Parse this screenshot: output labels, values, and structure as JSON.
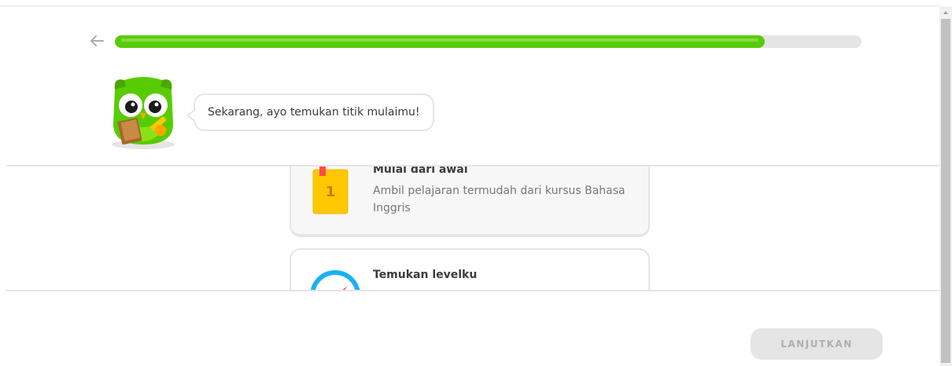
{
  "header": {
    "back_icon": "arrow-left-icon",
    "progress": 0.87
  },
  "mascot": {
    "speech": "Sekarang, ayo temukan titik mulaimu!"
  },
  "options": [
    {
      "title": "Mulai dari awal",
      "description": "Ambil pelajaran termudah dari kursus Bahasa Inggris",
      "icon": "book-icon",
      "icon_number": "1",
      "selected": true
    },
    {
      "title": "Temukan levelku",
      "icon": "compass-icon",
      "selected": false
    }
  ],
  "footer": {
    "continue_label": "LANJUTKAN"
  },
  "colors": {
    "progress_green": "#58cc02",
    "track_gray": "#e5e5e5",
    "disabled_text": "#afafaf"
  }
}
